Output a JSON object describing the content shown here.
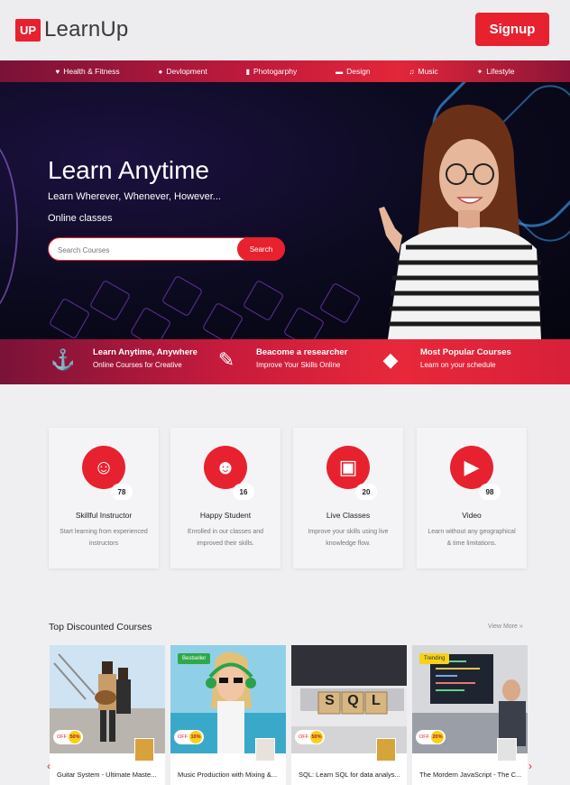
{
  "header": {
    "logo_badge": "UP",
    "logo_text": "LearnUp",
    "signup_label": "Signup"
  },
  "nav": [
    {
      "label": "Health & Fitness",
      "icon": "heart-icon"
    },
    {
      "label": "Devlopment",
      "icon": "globe-icon"
    },
    {
      "label": "Photogarphy",
      "icon": "document-icon"
    },
    {
      "label": "Design",
      "icon": "monitor-icon"
    },
    {
      "label": "Music",
      "icon": "music-icon"
    },
    {
      "label": "Lifestyle",
      "icon": "person-icon"
    }
  ],
  "hero": {
    "title": "Learn Anytime",
    "subtitle": "Learn Wherever, Whenever, However...",
    "online": "Online classes",
    "search_placeholder": "Search Courses",
    "search_button": "Search"
  },
  "features": [
    {
      "title": "Learn Anytime, Anywhere",
      "sub": "Online Courses for Creative",
      "icon": "anchor-icon"
    },
    {
      "title": "Beacome a researcher",
      "sub": "Improve Your Skills Online",
      "icon": "magic-wand-icon"
    },
    {
      "title": "Most Popular Courses",
      "sub": "Learn on your schedule",
      "icon": "graduation-cap-icon"
    }
  ],
  "stats": [
    {
      "count": "78",
      "title": "Skillful Instructor",
      "desc": "Start learning from experienced instructors",
      "icon": "instructor-icon"
    },
    {
      "count": "16",
      "title": "Happy Student",
      "desc": "Enrolled in our classes and improved their skills.",
      "icon": "student-icon"
    },
    {
      "count": "20",
      "title": "Live Classes",
      "desc": "Improve your skills using live knowledge flow.",
      "icon": "live-icon"
    },
    {
      "count": "98",
      "title": "Video",
      "desc": "Learn without any geographical & time limitations.",
      "icon": "video-icon"
    }
  ],
  "courses_section": {
    "title": "Top Discounted Courses",
    "view_more": "View More »"
  },
  "courses": [
    {
      "name": "Guitar System - Ultimate Maste...",
      "off": "OFF",
      "pct": "50%",
      "tag": ""
    },
    {
      "name": "Music Production with Mixing &...",
      "off": "OFF",
      "pct": "10%",
      "tag": "Bestseller"
    },
    {
      "name": "SQL: Learn SQL for data analys...",
      "off": "OFF",
      "pct": "50%",
      "tag": ""
    },
    {
      "name": "The Mordern JavaScript - The C...",
      "off": "OFF",
      "pct": "20%",
      "tag": "Trending"
    }
  ],
  "sql_block_text": "SQL",
  "arrows": {
    "prev": "‹",
    "next": "›"
  }
}
